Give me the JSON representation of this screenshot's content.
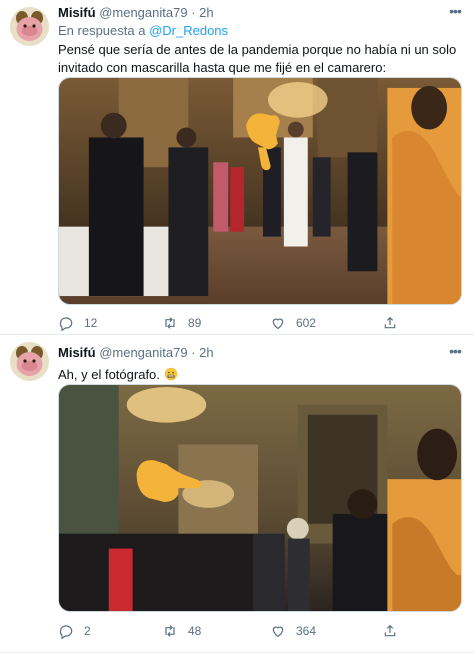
{
  "tweets": [
    {
      "name": "Misifú",
      "handle": "@menganita79",
      "separator": "·",
      "time": "2h",
      "reply_prefix": "En respuesta a",
      "reply_mention": "@Dr_Redons",
      "text": "Pensé que sería de antes de la pandemia porque no había ni un solo invitado con mascarilla hasta que me fijé en el camarero:",
      "replies": "12",
      "retweets": "89",
      "likes": "602"
    },
    {
      "name": "Misifú",
      "handle": "@menganita79",
      "separator": "·",
      "time": "2h",
      "text": "Ah, y el fotógrafo.",
      "text_emoji": "grimacing-face-emoji",
      "replies": "2",
      "retweets": "48",
      "likes": "364"
    }
  ],
  "colors": {
    "secondary_text": "#5b7083",
    "link": "#1da1f2",
    "divider": "#e6ecf0",
    "pointing_emoji": "#f4b43a"
  },
  "icons": [
    "more-icon",
    "reply-icon",
    "retweet-icon",
    "like-icon",
    "share-icon",
    "pointing-hand-emoji"
  ]
}
